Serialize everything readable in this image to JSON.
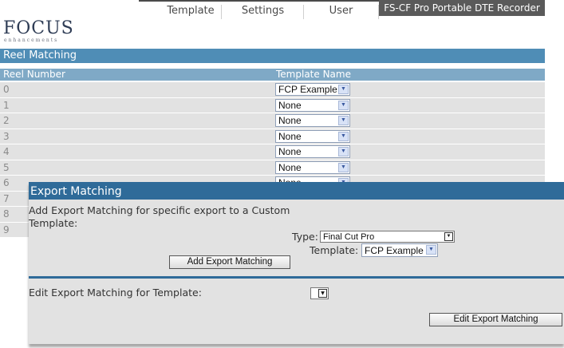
{
  "nav": {
    "tabs": [
      {
        "label": "Template"
      },
      {
        "label": "Settings"
      },
      {
        "label": "User"
      }
    ],
    "product_title": "FS-CF Pro Portable DTE Recorder"
  },
  "logo": {
    "word": "FOCUS",
    "sub": "enhancements"
  },
  "reel_matching": {
    "title": "Reel Matching",
    "col_reel": "Reel Number",
    "col_template": "Template Name",
    "rows": [
      {
        "num": "0",
        "template": "FCP Example"
      },
      {
        "num": "1",
        "template": "None"
      },
      {
        "num": "2",
        "template": "None"
      },
      {
        "num": "3",
        "template": "None"
      },
      {
        "num": "4",
        "template": "None"
      },
      {
        "num": "5",
        "template": "None"
      },
      {
        "num": "6",
        "template": "None"
      },
      {
        "num": "7",
        "template": ""
      },
      {
        "num": "8",
        "template": ""
      },
      {
        "num": "9",
        "template": ""
      }
    ]
  },
  "export_matching": {
    "title": "Export Matching",
    "description": "Add Export Matching for specific export to a Custom Template:",
    "type_label": "Type:",
    "type_value": "Final Cut Pro",
    "template_label": "Template:",
    "template_value": "FCP Example",
    "add_button": "Add Export Matching",
    "edit_label": "Edit Export Matching for Template:",
    "edit_value": "",
    "edit_button": "Edit Export Matching"
  },
  "colors": {
    "reel_header": "#4f8db6",
    "panel_header": "#2f6b99",
    "row_bg": "#e2e2e2",
    "title_bar": "#5a5a5a"
  }
}
